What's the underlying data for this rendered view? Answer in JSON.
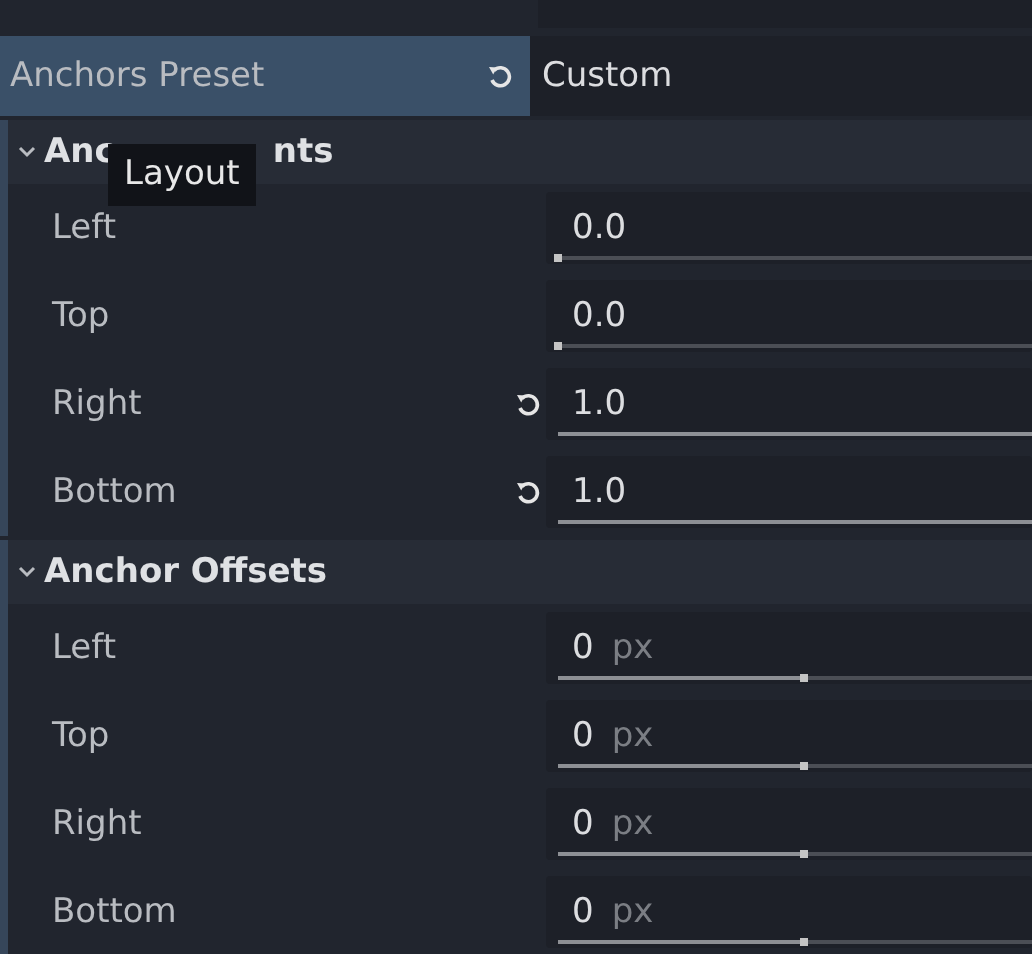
{
  "preset": {
    "label": "Anchors Preset",
    "value": "Custom",
    "selected": true,
    "reset": true
  },
  "sections": [
    {
      "title": [
        "Anc",
        "nts"
      ],
      "expanded": true,
      "rows": [
        {
          "label": "Left",
          "value": "0.0",
          "level": 0,
          "reset": false
        },
        {
          "label": "Top",
          "value": "0.0",
          "level": 0,
          "reset": false
        },
        {
          "label": "Right",
          "value": "1.0",
          "level": 1,
          "reset": true
        },
        {
          "label": "Bottom",
          "value": "1.0",
          "level": 1,
          "reset": true
        }
      ]
    },
    {
      "title": [
        "Anchor Offsets"
      ],
      "expanded": true,
      "rows": [
        {
          "label": "Left",
          "value": "0",
          "unit": "px",
          "level": 0.52,
          "reset": false
        },
        {
          "label": "Top",
          "value": "0",
          "unit": "px",
          "level": 0.52,
          "reset": false
        },
        {
          "label": "Right",
          "value": "0",
          "unit": "px",
          "level": 0.52,
          "reset": false
        },
        {
          "label": "Bottom",
          "value": "0",
          "unit": "px",
          "level": 0.52,
          "reset": false
        }
      ]
    }
  ],
  "tooltip": {
    "text": "Layout"
  }
}
